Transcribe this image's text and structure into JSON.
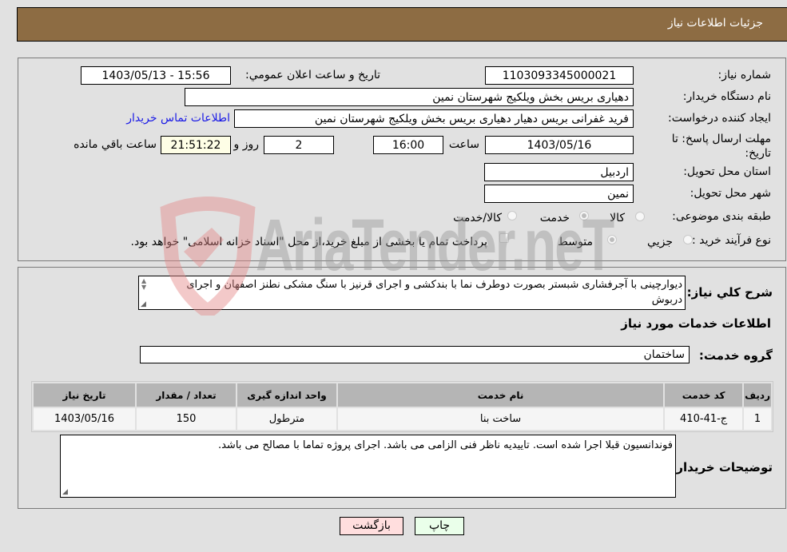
{
  "header": {
    "title": "جزئیات اطلاعات نیاز"
  },
  "need_info": {
    "need_number_label": "شماره نیاز:",
    "need_number": "1103093345000021",
    "announce_label": "تاریخ و ساعت اعلان عمومي:",
    "announce_value": "1403/05/13 - 15:56",
    "buyer_org_label": "نام دستگاه خریدار:",
    "buyer_org": "دهیاری بریس بخش ویلکیج شهرستان نمین",
    "creator_label": "ایجاد کننده درخواست:",
    "creator": "فرید غفرانی بریس دهیار دهیاری بریس بخش ویلکیج شهرستان نمین",
    "contact_link": "اطلاعات تماس خریدار",
    "deadline_label": "مهلت ارسال پاسخ: تا تاریخ:",
    "deadline_date": "1403/05/16",
    "time_label": "ساعت",
    "deadline_time": "16:00",
    "days_value": "2",
    "days_label": "روز و",
    "remaining_time": "21:51:22",
    "remaining_label": "ساعت باقي مانده",
    "province_label": "استان محل تحویل:",
    "province": "اردبیل",
    "city_label": "شهر محل تحویل:",
    "city": "نمین",
    "category_label": "طبقه بندی موضوعی:",
    "category_options": [
      {
        "label": "کالا",
        "checked": false
      },
      {
        "label": "خدمت",
        "checked": true
      },
      {
        "label": "کالا/خدمت",
        "checked": false
      }
    ],
    "process_label": "نوع فرآیند خرید :",
    "process_options": [
      {
        "label": "جزیي",
        "checked": false
      },
      {
        "label": "متوسط",
        "checked": true
      }
    ],
    "treasury_note": "پرداخت تمام یا بخشی از مبلغ خرید،از محل \"اسناد خزانه اسلامی\" خواهد بود."
  },
  "description": {
    "label": "شرح کلي نیاز:",
    "text": "دیوارچینی با آجرفشاری شبستر بصورت دوطرف نما با بندکشی و اجرای قرنیز با سنگ مشکی نطنز اصفهان و اجرای دربوش",
    "services_title": "اطلاعات خدمات مورد نیاز",
    "service_group_label": "گروه خدمت:",
    "service_group": "ساختمان"
  },
  "table": {
    "headers": [
      "ردیف",
      "کد خدمت",
      "نام خدمت",
      "واحد اندازه گیری",
      "تعداد / مقدار",
      "تاریخ نیاز"
    ],
    "rows": [
      [
        "1",
        "ج-41-410",
        "ساخت بنا",
        "مترطول",
        "150",
        "1403/05/16"
      ]
    ]
  },
  "buyer_notes": {
    "label": "توضیحات خریدار:",
    "text": "فوندانسیون قبلا اجرا شده است. تاییدیه ناظر فنی الزامی می باشد. اجرای پروژه تماما با مصالح می باشد."
  },
  "buttons": {
    "print": "چاپ",
    "back": "بازگشت"
  },
  "watermark": {
    "text": "AriaTender.neT"
  },
  "colors": {
    "header_bg": "#8d6c43",
    "print_bg": "#eaffea",
    "back_bg": "#ffdede",
    "link": "#1a1ae6"
  }
}
